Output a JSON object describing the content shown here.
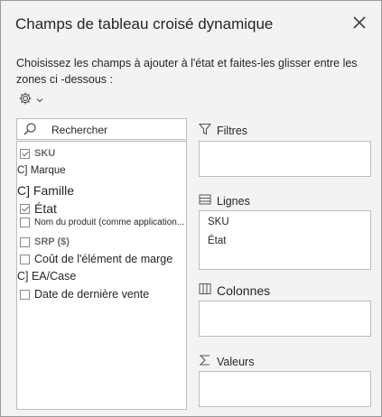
{
  "pane": {
    "title": "Champs de tableau croisé dynamique",
    "description": "Choisissez les champs à ajouter à l'état et faites-les glisser entre les zones ci -dessous :"
  },
  "search": {
    "label": "Rechercher"
  },
  "fields": [
    {
      "label": "SKU",
      "checked": true,
      "style": "bold-gray"
    },
    {
      "label": "C] Marque",
      "checked": null,
      "style": "plain"
    },
    {
      "label": "C] Famille",
      "checked": null,
      "style": "plain-large"
    },
    {
      "label": "État",
      "checked": true,
      "style": "large"
    },
    {
      "label": "Nom du produit (comme application...",
      "checked": false,
      "style": "small"
    },
    {
      "label": "SRP ($)",
      "checked": false,
      "style": "bold-gray"
    },
    {
      "label": "Coût de l'élément de marge",
      "checked": false,
      "style": "medium"
    },
    {
      "label": "C] EA/Case",
      "checked": null,
      "style": "plain"
    },
    {
      "label": "Date de dernière vente",
      "checked": false,
      "style": "medium"
    }
  ],
  "areas": {
    "filters": {
      "label": "Filtres",
      "icon": "filter-icon",
      "items": []
    },
    "rows": {
      "label": "Lignes",
      "icon": "rows-icon",
      "items": [
        "SKU",
        "État"
      ]
    },
    "columns": {
      "label": "Colonnes",
      "icon": "columns-icon",
      "items": []
    },
    "values": {
      "label": "Valeurs",
      "icon": "sigma-icon",
      "items": []
    }
  },
  "colors": {
    "pane_bg": "#f3f3f3",
    "border": "#bdbdbd",
    "text": "#262626",
    "muted": "#6a6a6a"
  }
}
